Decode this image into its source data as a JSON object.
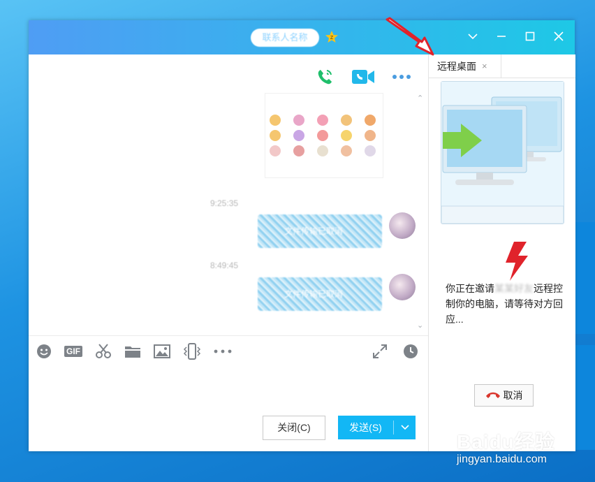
{
  "window": {
    "title": "联系人名称",
    "controls": {
      "collapse": "chevron-down",
      "minimize": "minimize",
      "maximize": "maximize",
      "close": "close"
    }
  },
  "chat": {
    "header_icons": [
      "phone-icon",
      "video-call-icon",
      "more-icon"
    ],
    "messages": [
      {
        "type": "image",
        "desc_hidden": true
      },
      {
        "type": "timestamp",
        "text": "9:25:35"
      },
      {
        "type": "file",
        "text": "文件传输已取消"
      },
      {
        "type": "timestamp",
        "text": "8:49:45"
      },
      {
        "type": "file",
        "text": "文件传输已取消"
      }
    ],
    "toolbar": {
      "gif_label": "GIF",
      "tools": [
        "emoji-icon",
        "gif-icon",
        "scissors-icon",
        "folder-icon",
        "image-icon",
        "shake-icon",
        "more-tools-icon"
      ],
      "right": [
        "expand-icon",
        "history-icon"
      ]
    },
    "buttons": {
      "close_label": "关闭(C)",
      "send_label": "发送(S)"
    }
  },
  "panel": {
    "tab_label": "远程桌面",
    "tab_close": "×",
    "invite_pre": "你正在邀请",
    "invite_name": "某某好友",
    "invite_post": "远程控制你的电脑，请等待对方回应...",
    "cancel_label": "取消"
  },
  "watermark": {
    "logo": "Baidu经验",
    "url": "jingyan.baidu.com"
  },
  "colors": {
    "accent": "#12b7f5",
    "titlebar_start": "#4f9df4",
    "titlebar_end": "#1ec8e6",
    "annotation": "#e0232b"
  }
}
